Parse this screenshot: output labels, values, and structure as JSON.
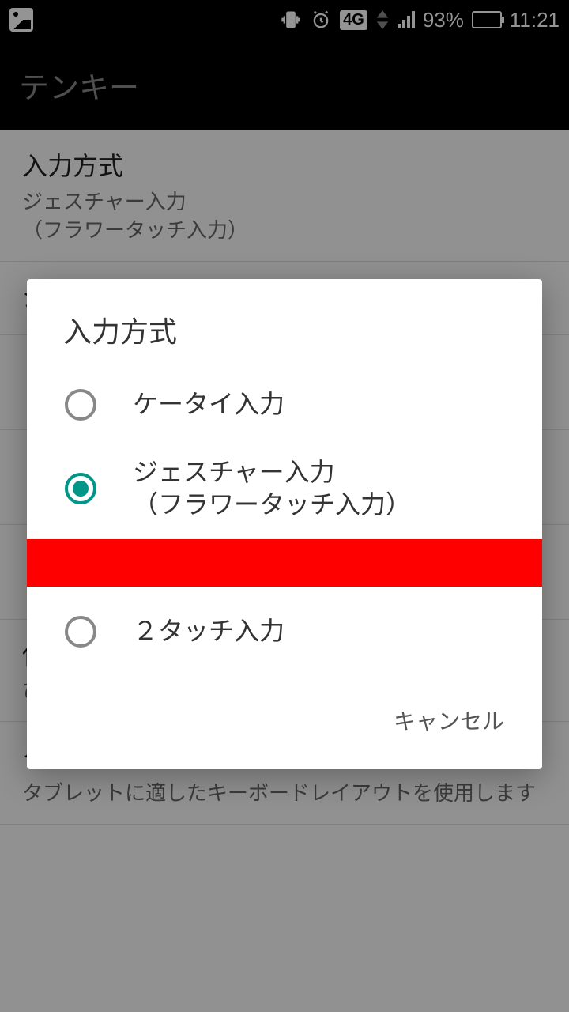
{
  "status": {
    "network_badge": "4G",
    "battery_pct": "93%",
    "time": "11:21"
  },
  "header": {
    "title": "テンキー"
  },
  "list": {
    "items": [
      {
        "title": "入力方式",
        "sub": "ジェスチャー入力\n（フラワータッチ入力）"
      },
      {
        "title": "ジェスチャー入力の設定",
        "sub": ""
      },
      {
        "title": "",
        "sub": ""
      },
      {
        "title": "",
        "sub": ""
      },
      {
        "title": "",
        "sub": ""
      },
      {
        "title": "使用するテンキ",
        "sub": "ひらがな+英字+数字"
      },
      {
        "title": "タブレット",
        "sub": "タブレットに適したキーボードレイアウトを使用します"
      }
    ]
  },
  "dialog": {
    "title": "入力方式",
    "options": [
      {
        "label": "ケータイ入力",
        "selected": false
      },
      {
        "label": "ジェスチャー入力\n（フラワータッチ入力）",
        "selected": true
      },
      {
        "label": "２タッチ入力",
        "selected": false
      }
    ],
    "cancel": "キャンセル"
  }
}
